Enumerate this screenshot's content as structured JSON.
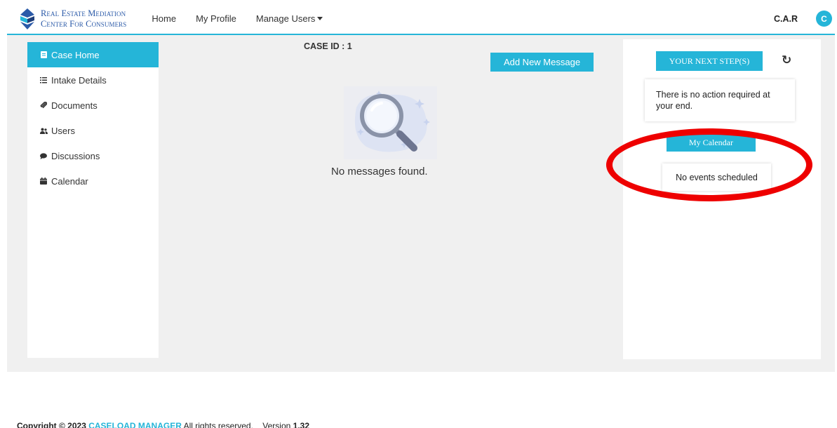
{
  "header": {
    "logo_line1": "Real Estate Mediation",
    "logo_line2": "Center For Consumers",
    "nav": {
      "home": "Home",
      "profile": "My Profile",
      "manage_users": "Manage Users"
    },
    "user_name": "C.A.R",
    "avatar_initial": "C"
  },
  "sidebar": {
    "items": [
      {
        "label": "Case Home",
        "icon": "file-icon",
        "active": true
      },
      {
        "label": "Intake Details",
        "icon": "list-icon"
      },
      {
        "label": "Documents",
        "icon": "paperclip-icon"
      },
      {
        "label": "Users",
        "icon": "users-icon"
      },
      {
        "label": "Discussions",
        "icon": "comment-icon"
      },
      {
        "label": "Calendar",
        "icon": "calendar-icon"
      }
    ]
  },
  "main": {
    "case_id": "CASE ID : 1",
    "add_message_label": "Add New Message",
    "empty_text": "No messages found."
  },
  "right_panel": {
    "next_step_label": "YOUR NEXT STEP(S)",
    "no_action_text": "There is no action required at your end.",
    "calendar_label": "My Calendar",
    "no_events_text": "No events scheduled"
  },
  "footer": {
    "copyright_prefix": "Copyright © 2023",
    "brand": "CASELOAD MANAGER",
    "rights": "All rights reserved.",
    "version_label": "Version",
    "version_number": "1.32"
  },
  "colors": {
    "accent": "#25b5d8",
    "highlight": "#ee0000",
    "logo_blue": "#2b5aa8",
    "background": "#f0f0f0"
  }
}
